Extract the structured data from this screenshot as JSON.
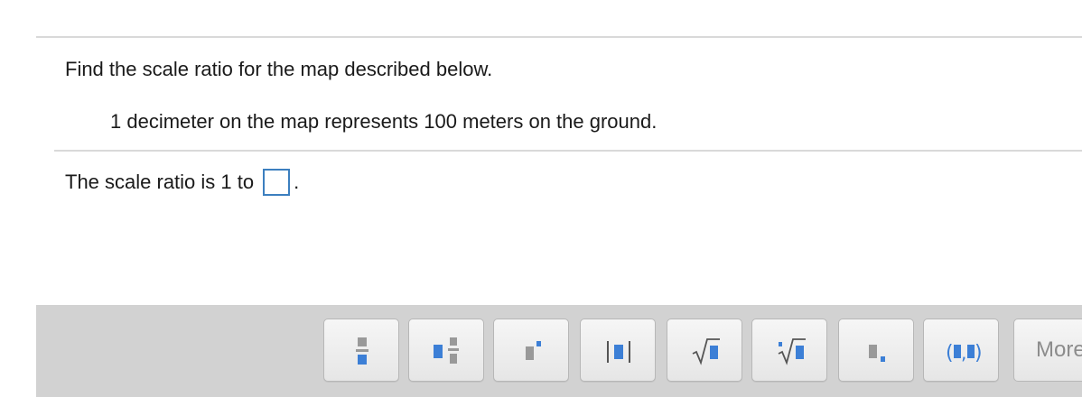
{
  "question": {
    "instruction": "Find the scale ratio for the map described below.",
    "given": "1 decimeter on the map represents 100 meters on the ground.",
    "answer_prefix": "The scale ratio is 1 to",
    "answer_suffix": ".",
    "answer_value": ""
  },
  "toolbar": {
    "buttons": [
      {
        "icon": "fraction-icon"
      },
      {
        "icon": "mixed-number-icon"
      },
      {
        "icon": "exponent-icon"
      },
      {
        "icon": "absolute-value-icon"
      },
      {
        "icon": "square-root-icon"
      },
      {
        "icon": "nth-root-icon"
      },
      {
        "icon": "subscript-icon"
      },
      {
        "icon": "ordered-pair-icon"
      }
    ],
    "more_label": "More",
    "colors": {
      "icon_gray": "#999999",
      "icon_blue": "#3c7fd6",
      "toolbar_bg": "#d2d2d2",
      "answer_border": "#3c7fbf"
    }
  }
}
